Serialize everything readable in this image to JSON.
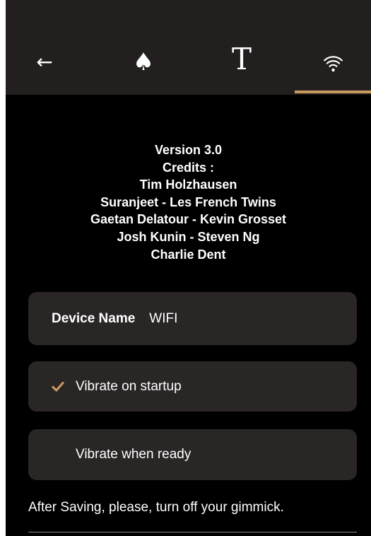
{
  "tabs": {
    "back_glyph": "←",
    "spade_glyph": "♠",
    "text_glyph": "T",
    "wifi_icon": "wifi-icon",
    "active": "wifi"
  },
  "credits": {
    "lines": [
      "Version 3.0",
      "Credits :",
      "Tim Holzhausen",
      "Suranjeet - Les French Twins",
      "Gaetan Delatour - Kevin Grosset",
      "Josh Kunin - Steven Ng",
      "Charlie Dent"
    ]
  },
  "device": {
    "label": "Device Name",
    "value": "WIFI"
  },
  "options": {
    "vibrate_startup": {
      "label": "Vibrate on startup",
      "checked": true
    },
    "vibrate_ready": {
      "label": "Vibrate when ready",
      "checked": false
    }
  },
  "note": "After Saving, please, turn off your gimmick.",
  "colors": {
    "topbar": "#231f1f",
    "accent": "#c89a5f",
    "card": "#2a2626",
    "background": "#000000",
    "text": "#ffffff"
  }
}
